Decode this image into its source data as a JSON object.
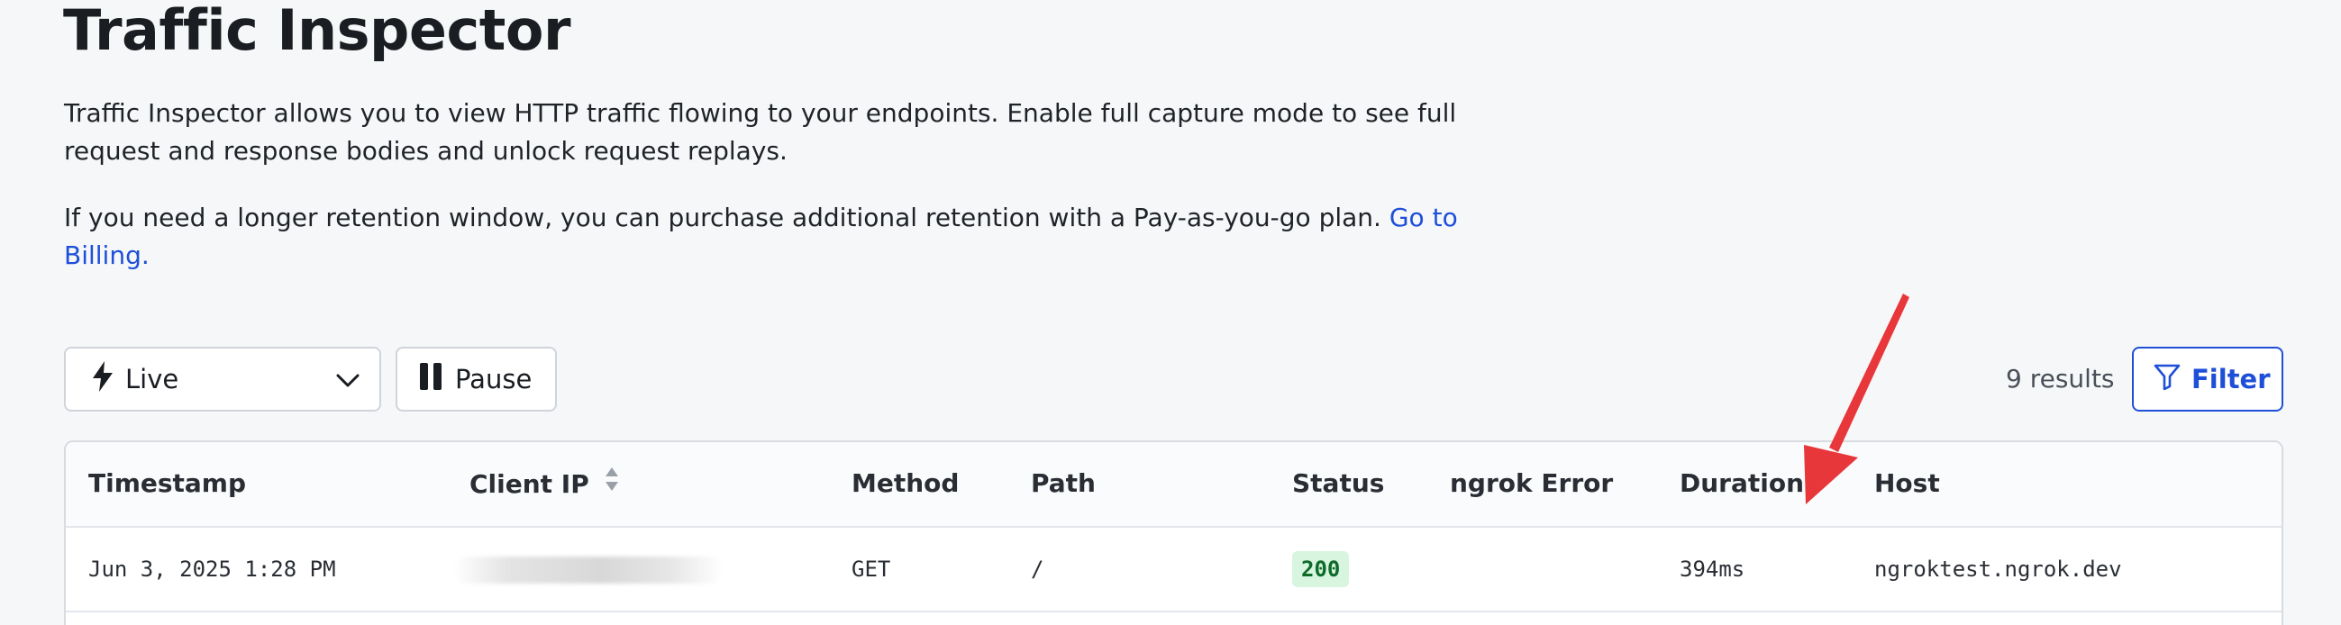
{
  "page": {
    "title": "Traffic Inspector",
    "paragraph1": "Traffic Inspector allows you to view HTTP traffic flowing to your endpoints. Enable full capture mode to see full request and response bodies and unlock request replays.",
    "paragraph2_text": "If you need a longer retention window, you can purchase additional retention with a Pay-as-you-go plan. ",
    "paragraph2_link": "Go to Billing."
  },
  "toolbar": {
    "live_label": "Live",
    "pause_label": "Pause",
    "results_text": "9 results",
    "filter_label": "Filter"
  },
  "table": {
    "headers": {
      "timestamp": "Timestamp",
      "client_ip": "Client IP",
      "method": "Method",
      "path": "Path",
      "status": "Status",
      "ngrok_error": "ngrok Error",
      "duration": "Duration",
      "host": "Host"
    },
    "rows": [
      {
        "timestamp": "Jun 3, 2025 1:28 PM",
        "method": "GET",
        "path": "/",
        "status": "200",
        "ngrok_error": "",
        "duration": "394ms",
        "host": "ngroktest.ngrok.dev"
      }
    ]
  },
  "colors": {
    "accent": "#1e4fd8",
    "status_ok_bg": "#d8f5df",
    "status_ok_text": "#0f6b2b",
    "annotation_arrow": "#e8373a"
  },
  "icons": {
    "live": "lightning-bolt-icon",
    "dropdown": "chevron-down-icon",
    "pause": "pause-icon",
    "filter": "funnel-icon",
    "sort": "sort-icon"
  }
}
